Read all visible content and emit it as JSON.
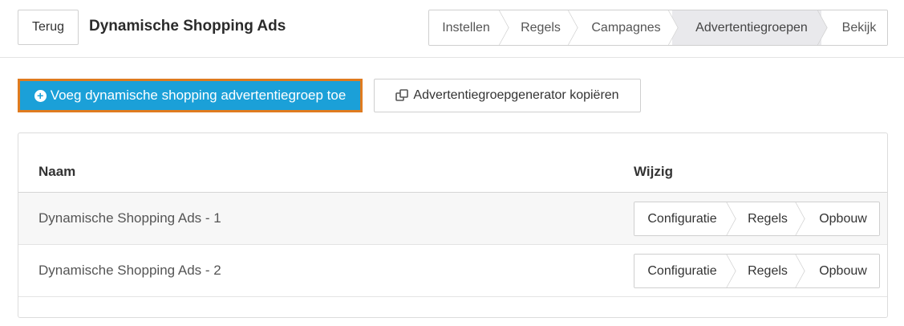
{
  "header": {
    "back_label": "Terug",
    "title": "Dynamische Shopping Ads",
    "steps": [
      {
        "label": "Instellen"
      },
      {
        "label": "Regels"
      },
      {
        "label": "Campagnes"
      },
      {
        "label": "Advertentiegroepen"
      },
      {
        "label": "Bekijk"
      }
    ],
    "active_step": "Advertentiegroepen"
  },
  "actions": {
    "add_icon": "plus-circle-icon",
    "add_label": "Voeg dynamische shopping advertentiegroep toe",
    "copy_icon": "copy-icon",
    "copy_label": "Advertentiegroepgenerator kopiëren"
  },
  "table": {
    "headers": {
      "name": "Naam",
      "edit": "Wijzig"
    },
    "rows": [
      {
        "name": "Dynamische Shopping Ads - 1",
        "actions": [
          {
            "label": "Configuratie"
          },
          {
            "label": "Regels"
          },
          {
            "label": "Opbouw"
          }
        ]
      },
      {
        "name": "Dynamische Shopping Ads - 2",
        "actions": [
          {
            "label": "Configuratie"
          },
          {
            "label": "Regels"
          },
          {
            "label": "Opbouw"
          }
        ]
      }
    ]
  },
  "colors": {
    "primary": "#1ba0d8",
    "highlight_border": "#e07b1f",
    "active_step_bg": "#e9e9ec"
  }
}
